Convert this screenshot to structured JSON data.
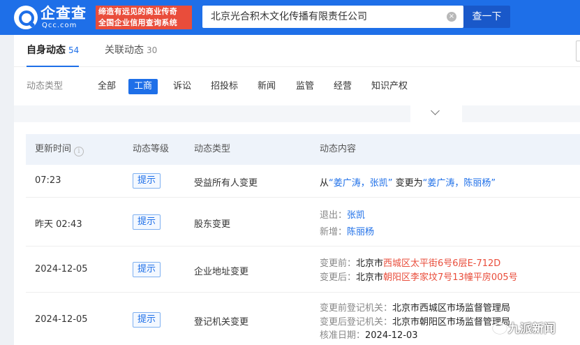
{
  "header": {
    "logo_cn": "企查查",
    "logo_en": "Qcc.com",
    "slogan_line1": "缔造有远见的商业传奇",
    "slogan_line2": "全国企业信用查询系统",
    "search_value": "北京光合积木文化传播有限责任公司",
    "search_button": "查一下",
    "clear_icon": "×"
  },
  "tabs": [
    {
      "label": "自身动态",
      "count": "54"
    },
    {
      "label": "关联动态",
      "count": "30"
    }
  ],
  "filter": {
    "label": "动态类型",
    "chips": [
      "全部",
      "工商",
      "诉讼",
      "招投标",
      "新闻",
      "监管",
      "经营",
      "知识产权"
    ],
    "active": "工商"
  },
  "table": {
    "headers": [
      "更新时间",
      "动态等级",
      "动态类型",
      "动态内容"
    ],
    "info_icon": "i",
    "rows": [
      {
        "time": "07:23",
        "level": "提示",
        "type": "受益所有人变更",
        "c_from": "从",
        "c_old": "“姜广涛，张凯”",
        "c_mid": "变更为",
        "c_new": "“姜广涛，陈丽杨”"
      },
      {
        "time": "昨天 02:43",
        "level": "提示",
        "type": "股东变更",
        "exit_label": "退出：",
        "exit_value": "张凯",
        "add_label": "新增：",
        "add_value": "陈丽杨"
      },
      {
        "time": "2024-12-05",
        "level": "提示",
        "type": "企业地址变更",
        "before_label": "变更前：",
        "before_city": "北京市",
        "before_addr": "西城区太平街6号6层E-712D",
        "after_label": "变更后：",
        "after_city": "北京市",
        "after_addr": "朝阳区李家坟7号13幢平房005号"
      },
      {
        "time": "2024-12-05",
        "level": "提示",
        "type": "登记机关变更",
        "before_label": "变更前登记机关：",
        "before_value": "北京市西城区市场监督管理局",
        "after_label": "变更后登记机关：",
        "after_value": "北京市朝阳区市场监督管理局",
        "date_label": "核准日期：",
        "date_value": "2024-12-03"
      }
    ]
  },
  "watermark": "九派新闻",
  "colors": {
    "brand": "#1e6fe8",
    "slogan": "#e94d3b",
    "highlight": "#e94d3b"
  }
}
